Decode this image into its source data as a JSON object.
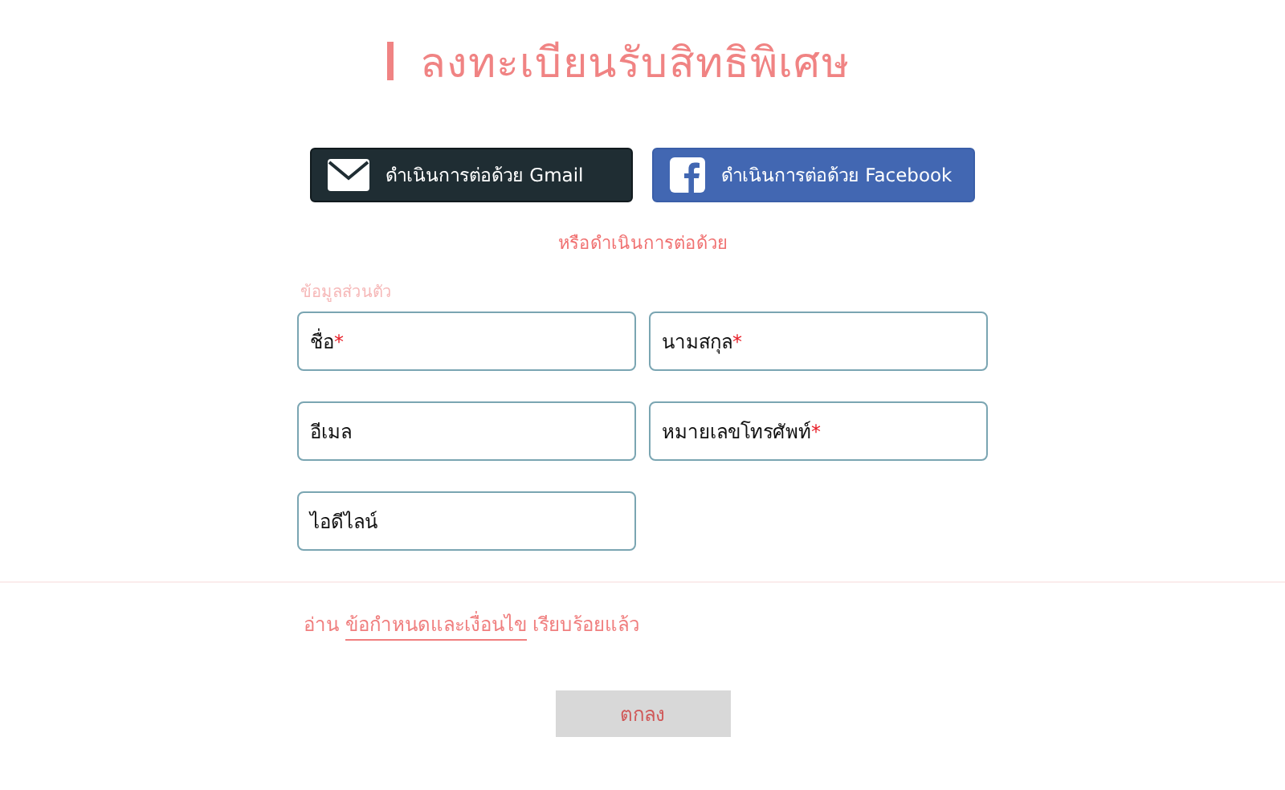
{
  "title": "ลงทะเบียนรับสิทธิพิเศษ",
  "social_buttons": [
    {
      "kind": "gmail",
      "label": "ดำเนินการต่อด้วย Gmail"
    },
    {
      "kind": "facebook",
      "label": "ดำเนินการต่อด้วย Facebook"
    }
  ],
  "or_text": "หรือดำเนินการต่อด้วย",
  "section_label": "ข้อมูลส่วนตัว",
  "fields": [
    {
      "placeholder": "ชื่อ",
      "required_mark": "*"
    },
    {
      "placeholder": "นามสกุล",
      "required_mark": "*"
    },
    {
      "placeholder": "อีเมล"
    },
    {
      "placeholder": "หมายเลขโทรศัพท์",
      "required_mark": "*"
    },
    {
      "placeholder": "ไอดีไลน์"
    }
  ],
  "terms": {
    "before": "อ่าน",
    "link": "ข้อกำหนดและเงื่อนไข",
    "after": "เรียบร้อยแล้ว"
  },
  "submit": {
    "label": "ตกลง",
    "disabled": true
  }
}
